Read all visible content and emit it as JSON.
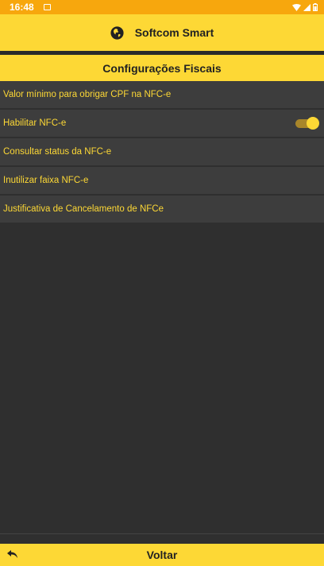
{
  "status_bar": {
    "time": "16:48"
  },
  "app_bar": {
    "title": "Softcom Smart",
    "icon": "globe-icon"
  },
  "section": {
    "title": "Configurações Fiscais"
  },
  "settings": {
    "items": [
      {
        "label": "Valor mínimo para obrigar CPF na NFC-e"
      },
      {
        "label": "Habilitar NFC-e",
        "toggle_on": true
      },
      {
        "label": "Consultar status da NFC-e"
      },
      {
        "label": "Inutilizar faixa NFC-e"
      },
      {
        "label": "Justificativa de Cancelamento de NFCe"
      }
    ]
  },
  "bottom_bar": {
    "back_label": "Voltar",
    "icon": "back-arrow-icon"
  },
  "colors": {
    "accent": "#fdd835",
    "status_bar": "#f7a70d",
    "background": "#2f2f2f",
    "item_background": "#3d3d3d"
  }
}
